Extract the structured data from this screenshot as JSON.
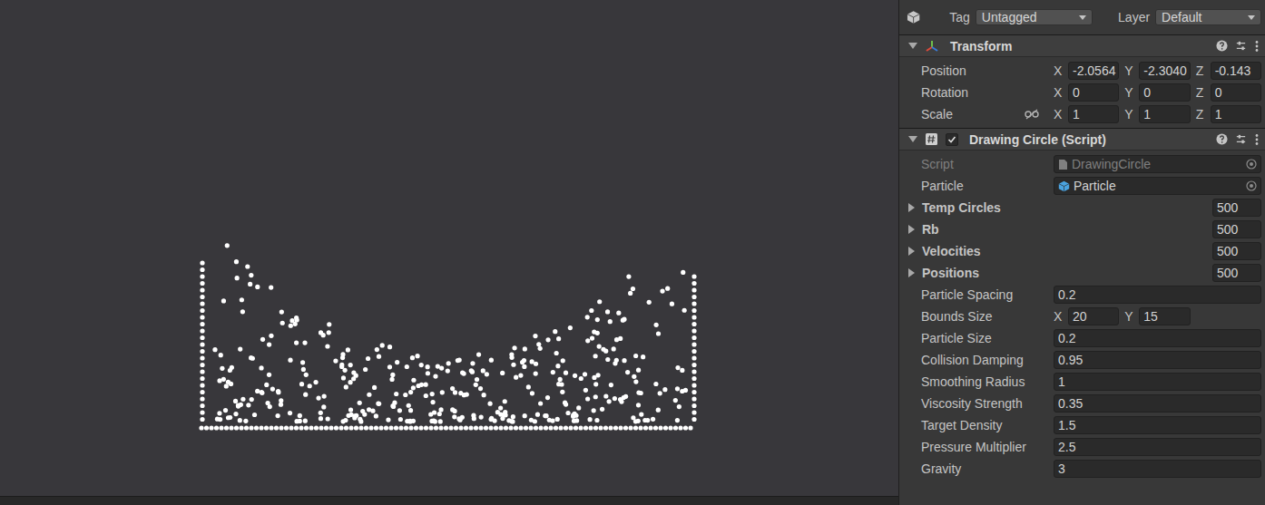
{
  "scene": {
    "particles_shown": true
  },
  "object_header": {
    "tag_label": "Tag",
    "tag_value": "Untagged",
    "layer_label": "Layer",
    "layer_value": "Default"
  },
  "components": [
    {
      "title": "Transform",
      "expanded": true,
      "has_toggle": false,
      "enabled": true,
      "rows": [
        {
          "kind": "vector",
          "label": "Position",
          "linked": false,
          "axes": [
            {
              "axis": "X",
              "value": "-2.0564"
            },
            {
              "axis": "Y",
              "value": "-2.3040"
            },
            {
              "axis": "Z",
              "value": "-0.143"
            }
          ]
        },
        {
          "kind": "vector",
          "label": "Rotation",
          "linked": false,
          "axes": [
            {
              "axis": "X",
              "value": "0"
            },
            {
              "axis": "Y",
              "value": "0"
            },
            {
              "axis": "Z",
              "value": "0"
            }
          ]
        },
        {
          "kind": "vector",
          "label": "Scale",
          "linked": true,
          "axes": [
            {
              "axis": "X",
              "value": "1"
            },
            {
              "axis": "Y",
              "value": "1"
            },
            {
              "axis": "Z",
              "value": "1"
            }
          ]
        }
      ]
    },
    {
      "title": "Drawing Circle (Script)",
      "expanded": true,
      "has_toggle": true,
      "enabled": true,
      "rows": [
        {
          "kind": "object",
          "label": "Script",
          "value": "DrawingCircle",
          "disabled": true
        },
        {
          "kind": "object",
          "label": "Particle",
          "value": "Particle",
          "disabled": false
        },
        {
          "kind": "array",
          "label": "Temp Circles",
          "value": "500",
          "expanded": false
        },
        {
          "kind": "array",
          "label": "Rb",
          "value": "500",
          "expanded": false
        },
        {
          "kind": "array",
          "label": "Velocities",
          "value": "500",
          "expanded": false
        },
        {
          "kind": "array",
          "label": "Positions",
          "value": "500",
          "expanded": false
        },
        {
          "kind": "float",
          "label": "Particle Spacing",
          "value": "0.2"
        },
        {
          "kind": "vector",
          "label": "Bounds Size",
          "linked": false,
          "axes": [
            {
              "axis": "X",
              "value": "20"
            },
            {
              "axis": "Y",
              "value": "15"
            }
          ]
        },
        {
          "kind": "float",
          "label": "Particle Size",
          "value": "0.2"
        },
        {
          "kind": "float",
          "label": "Collision Damping",
          "value": "0.95"
        },
        {
          "kind": "float",
          "label": "Smoothing Radius",
          "value": "1"
        },
        {
          "kind": "float",
          "label": "Viscosity Strength",
          "value": "0.35"
        },
        {
          "kind": "float",
          "label": "Target Density",
          "value": "1.5"
        },
        {
          "kind": "float",
          "label": "Pressure Multiplier",
          "value": "2.5"
        },
        {
          "kind": "float",
          "label": "Gravity",
          "value": "3"
        }
      ]
    }
  ]
}
